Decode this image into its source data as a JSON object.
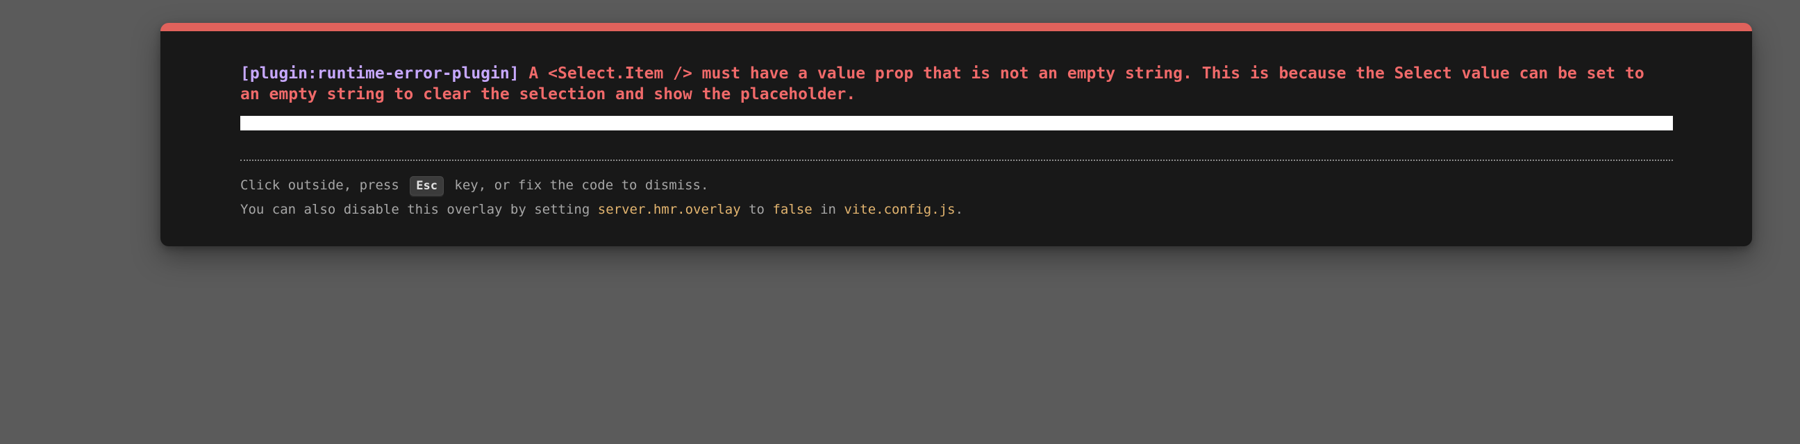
{
  "error": {
    "plugin": "[plugin:runtime-error-plugin]",
    "message": " A <Select.Item /> must have a value prop that is not an empty string. This is because the Select value can be set to an empty string to clear the selection and show the placeholder."
  },
  "tip": {
    "line1_prefix": "Click outside, press ",
    "key": "Esc",
    "line1_suffix": " key, or fix the code to dismiss.",
    "line2_prefix": "You can also disable this overlay by setting ",
    "setting": "server.hmr.overlay",
    "to": " to ",
    "value": "false",
    "in": " in ",
    "file": "vite.config.js",
    "end": "."
  },
  "colors": {
    "accent_bar": "#e0625c",
    "error_text": "#f06a6a",
    "plugin_text": "#c7a8ff",
    "code_text": "#e2b46f",
    "window_bg": "#181818",
    "backdrop": "#5b5b5b"
  }
}
